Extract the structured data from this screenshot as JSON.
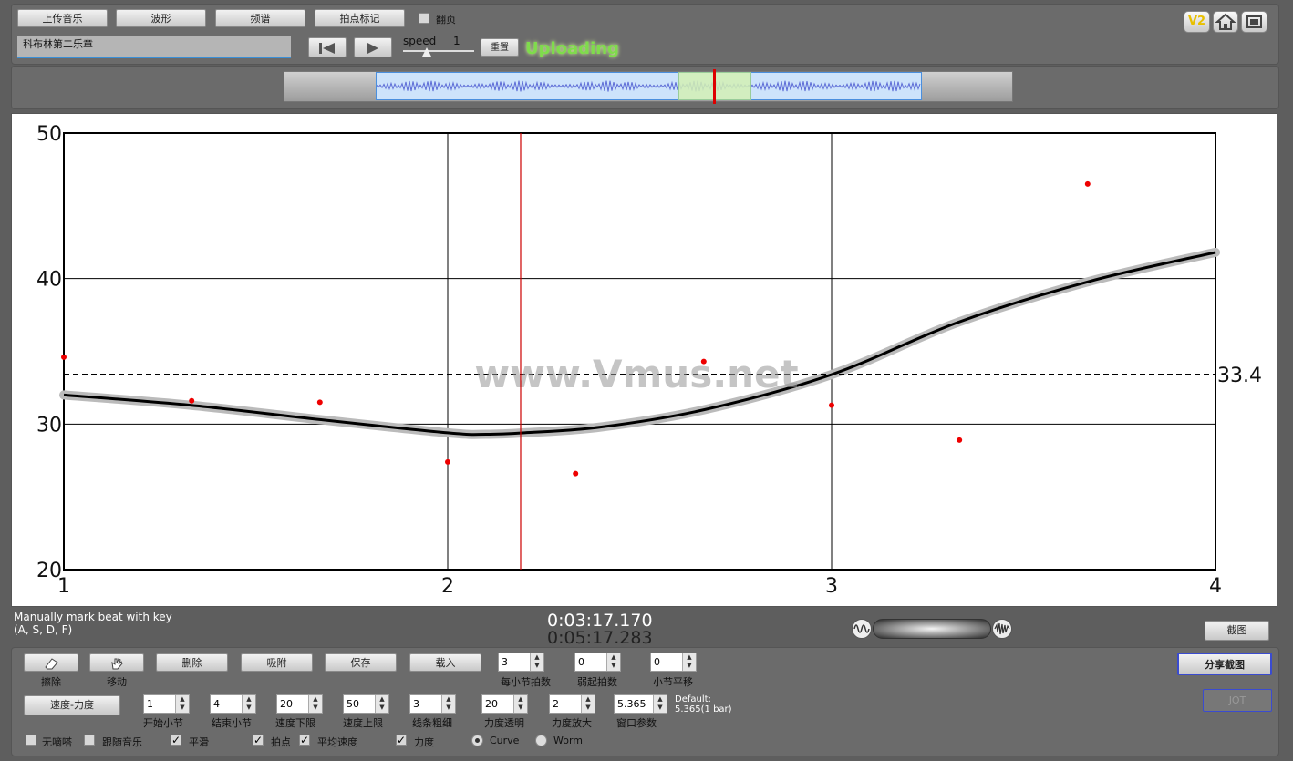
{
  "toolbar": {
    "upload_music": "上传音乐",
    "waveform": "波形",
    "spectrum": "频谱",
    "beat_mark": "拍点标记",
    "page_turn": "翻页",
    "reset": "重置",
    "speed_label": "speed",
    "speed_value": "1",
    "status": "Uploading",
    "v2_label": "V2",
    "title_value": "科布林第二乐章"
  },
  "chart_data": {
    "type": "scatter",
    "xlim": [
      1,
      4
    ],
    "ylim": [
      20,
      50
    ],
    "xticks": [
      "1",
      "2",
      "3",
      "4"
    ],
    "yticks": [
      "20",
      "30",
      "40",
      "50"
    ],
    "grid": true,
    "mean_value": 33.4,
    "mean_label": "33.4",
    "playhead_x": 2.19,
    "watermark": "www.Vmus.net",
    "points": [
      {
        "x": 1.0,
        "y": 34.6
      },
      {
        "x": 1.333,
        "y": 31.6
      },
      {
        "x": 1.667,
        "y": 31.5
      },
      {
        "x": 2.0,
        "y": 27.4
      },
      {
        "x": 2.333,
        "y": 26.6
      },
      {
        "x": 2.667,
        "y": 34.3
      },
      {
        "x": 3.0,
        "y": 31.3
      },
      {
        "x": 3.333,
        "y": 28.9
      },
      {
        "x": 3.667,
        "y": 46.5
      }
    ],
    "curve": [
      {
        "x": 1.0,
        "y": 32.0
      },
      {
        "x": 1.33,
        "y": 31.3
      },
      {
        "x": 1.67,
        "y": 30.3
      },
      {
        "x": 2.0,
        "y": 29.4
      },
      {
        "x": 2.1,
        "y": 29.3
      },
      {
        "x": 2.2,
        "y": 29.4
      },
      {
        "x": 2.4,
        "y": 29.8
      },
      {
        "x": 2.67,
        "y": 31.0
      },
      {
        "x": 3.0,
        "y": 33.4
      },
      {
        "x": 3.33,
        "y": 37.0
      },
      {
        "x": 3.67,
        "y": 39.8
      },
      {
        "x": 4.0,
        "y": 41.8
      }
    ]
  },
  "info": {
    "manual_mark": "Manually mark beat with key",
    "keys": "(A, S, D, F)",
    "current_time": "0:03:17.170",
    "total_time": "0:05:17.283",
    "screenshot": "截图",
    "share_screenshot": "分享截图",
    "jot": "JOT"
  },
  "controls": {
    "erase": "擦除",
    "move": "移动",
    "delete": "删除",
    "snap": "吸附",
    "save": "保存",
    "load": "载入",
    "beats_per_bar": {
      "value": "3",
      "label": "每小节拍数"
    },
    "upbeat": {
      "value": "0",
      "label": "弱起拍数"
    },
    "bar_shift": {
      "value": "0",
      "label": "小节平移"
    },
    "tempo_dynamics": "速度-力度",
    "start_bar": {
      "value": "1",
      "label": "开始小节"
    },
    "end_bar": {
      "value": "4",
      "label": "结束小节"
    },
    "tempo_min": {
      "value": "20",
      "label": "速度下限"
    },
    "tempo_max": {
      "value": "50",
      "label": "速度上限"
    },
    "line_width": {
      "value": "3",
      "label": "线条粗细"
    },
    "dyn_opacity": {
      "value": "20",
      "label": "力度透明"
    },
    "dyn_zoom": {
      "value": "2",
      "label": "力度放大"
    },
    "window_param": {
      "value": "5.365",
      "label": "窗口参数"
    },
    "default_note": "Default:",
    "default_value": "5.365(1 bar)",
    "no_click": "无嘀嗒",
    "follow_music": "跟随音乐",
    "smooth": "平滑",
    "beats": "拍点",
    "avg_tempo": "平均速度",
    "dynamics": "力度",
    "curve": "Curve",
    "worm": "Worm"
  }
}
